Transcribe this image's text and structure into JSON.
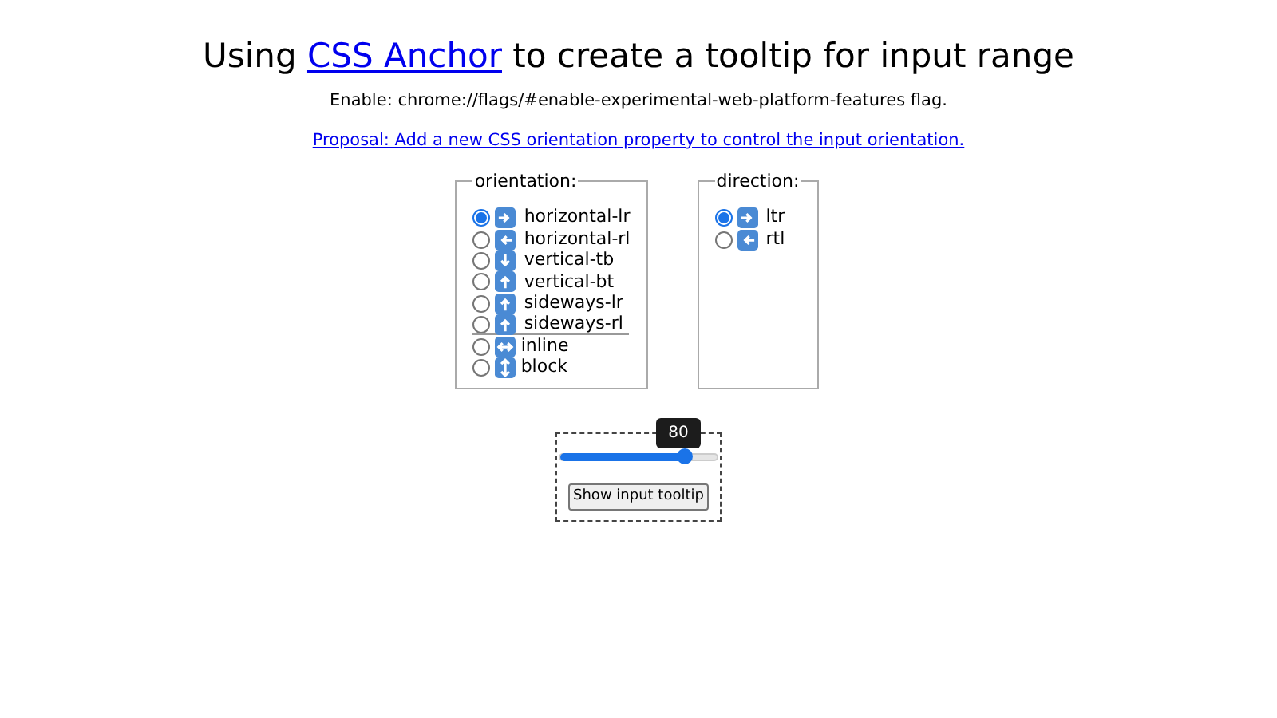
{
  "title": {
    "before": "Using ",
    "link": "CSS Anchor",
    "after": " to create a tooltip for input range"
  },
  "enable_note": "Enable: chrome://flags/#enable-experimental-web-platform-features flag.",
  "proposal_link": "Proposal: Add a new CSS orientation property to control the input orientation.",
  "orientation": {
    "legend": "orientation:",
    "options": [
      {
        "label": "horizontal-lr",
        "kind": "right",
        "selected": true
      },
      {
        "label": "horizontal-rl",
        "kind": "left",
        "selected": false
      },
      {
        "label": "vertical-tb",
        "kind": "down",
        "selected": false
      },
      {
        "label": "vertical-bt",
        "kind": "up",
        "selected": false
      },
      {
        "label": "sideways-lr",
        "kind": "up",
        "selected": false
      },
      {
        "label": "sideways-rl",
        "kind": "up",
        "selected": false
      },
      {
        "label": "inline",
        "kind": "leftright",
        "selected": false
      },
      {
        "label": "block",
        "kind": "updown",
        "selected": false
      }
    ]
  },
  "direction": {
    "legend": "direction:",
    "options": [
      {
        "label": "ltr",
        "kind": "right",
        "selected": true
      },
      {
        "label": "rtl",
        "kind": "left",
        "selected": false
      }
    ]
  },
  "range": {
    "level": 0.8,
    "tooltip": "80",
    "button": "Show input tooltip"
  }
}
